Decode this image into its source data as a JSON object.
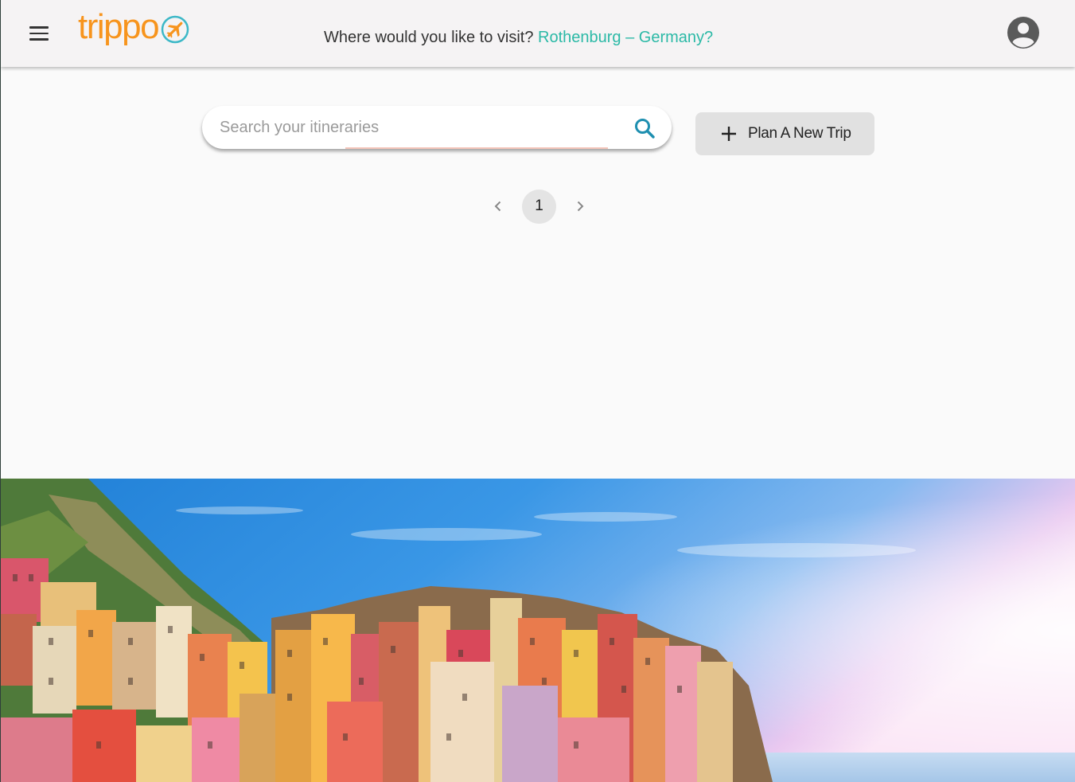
{
  "header": {
    "logo_text": "trippo",
    "tagline_prefix": "Where would you like to visit?",
    "tagline_destination": "Rothenburg – Germany?"
  },
  "search": {
    "placeholder": "Search your itineraries",
    "value": ""
  },
  "actions": {
    "plan_label": "Plan A New Trip"
  },
  "pagination": {
    "current_page": "1"
  },
  "colors": {
    "brand_orange": "#f7941d",
    "brand_teal": "#2bb9a6",
    "search_icon": "#1e8fb0"
  },
  "icons": {
    "menu": "menu-icon",
    "logo_mark": "plane-icon",
    "account": "account-circle-icon",
    "search": "search-icon",
    "add": "plus-icon",
    "prev": "chevron-left-icon",
    "next": "chevron-right-icon"
  }
}
